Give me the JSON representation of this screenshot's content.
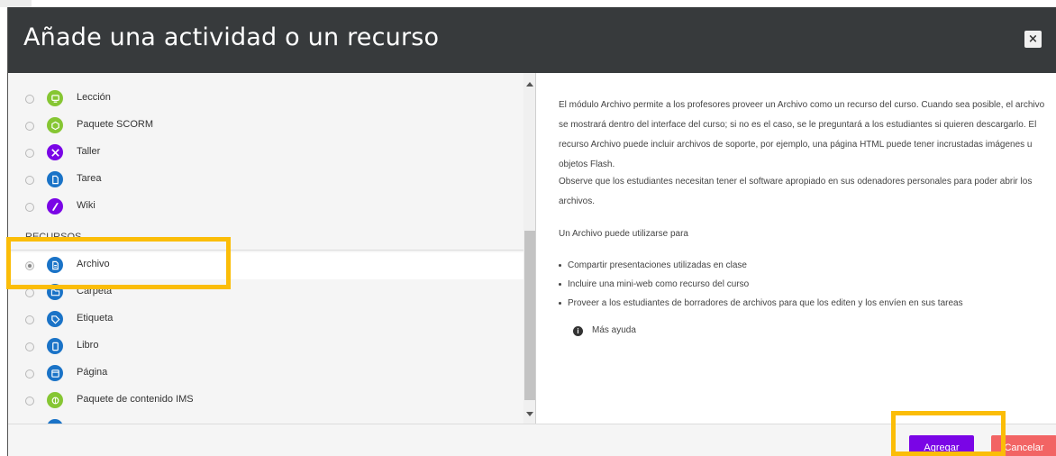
{
  "dialog": {
    "title": "Añade una actividad o un recurso",
    "close_symbol": "×"
  },
  "activities": [
    {
      "label": "Lección",
      "icon": "lesson-icon",
      "color": "#86c633"
    },
    {
      "label": "Paquete SCORM",
      "icon": "scorm-package-icon",
      "color": "#86c633"
    },
    {
      "label": "Taller",
      "icon": "workshop-icon",
      "color": "#7a05e6"
    },
    {
      "label": "Tarea",
      "icon": "assignment-icon",
      "color": "#1a73c7"
    },
    {
      "label": "Wiki",
      "icon": "wiki-icon",
      "color": "#7a05e6"
    }
  ],
  "resources_heading": "RECURSOS",
  "resources": [
    {
      "label": "Archivo",
      "icon": "file-icon",
      "color": "#1a73c7",
      "selected": true
    },
    {
      "label": "Carpeta",
      "icon": "folder-icon",
      "color": "#1a73c7",
      "selected": false
    },
    {
      "label": "Etiqueta",
      "icon": "label-icon",
      "color": "#1a73c7",
      "selected": false
    },
    {
      "label": "Libro",
      "icon": "book-icon",
      "color": "#1a73c7",
      "selected": false
    },
    {
      "label": "Página",
      "icon": "page-icon",
      "color": "#1a73c7",
      "selected": false
    },
    {
      "label": "Paquete de contenido IMS",
      "icon": "ims-package-icon",
      "color": "#86c633",
      "selected": false
    }
  ],
  "description": {
    "p1": "El módulo Archivo permite a los profesores proveer un Archivo como un recurso del curso. Cuando sea posible, el archivo se mostrará dentro del interface del curso; si no es el caso, se le preguntará a los estudiantes si quieren descargarlo. El recurso Archivo puede incluir archivos de soporte, por ejemplo, una página HTML puede tener incrustadas imágenes u objetos Flash.",
    "p2": "Observe que los estudiantes necesitan tener el software apropiado en sus odenadores personales para poder abrir los archivos.",
    "p3": "Un Archivo puede utilizarse para",
    "bullets": [
      "Compartir presentaciones utilizadas en clase",
      "Incluire una mini-web como recurso del curso",
      "Proveer a los estudiantes de borradores de archivos para que los editen y los envíen en sus tareas"
    ],
    "more_help": "Más ayuda"
  },
  "footer": {
    "add_label": "Agregar",
    "cancel_label": "Cancelar"
  },
  "colors": {
    "header": "#373a3c",
    "add_button": "#7a05e6",
    "cancel_button": "#f26464",
    "highlight": "#fbbd08"
  }
}
